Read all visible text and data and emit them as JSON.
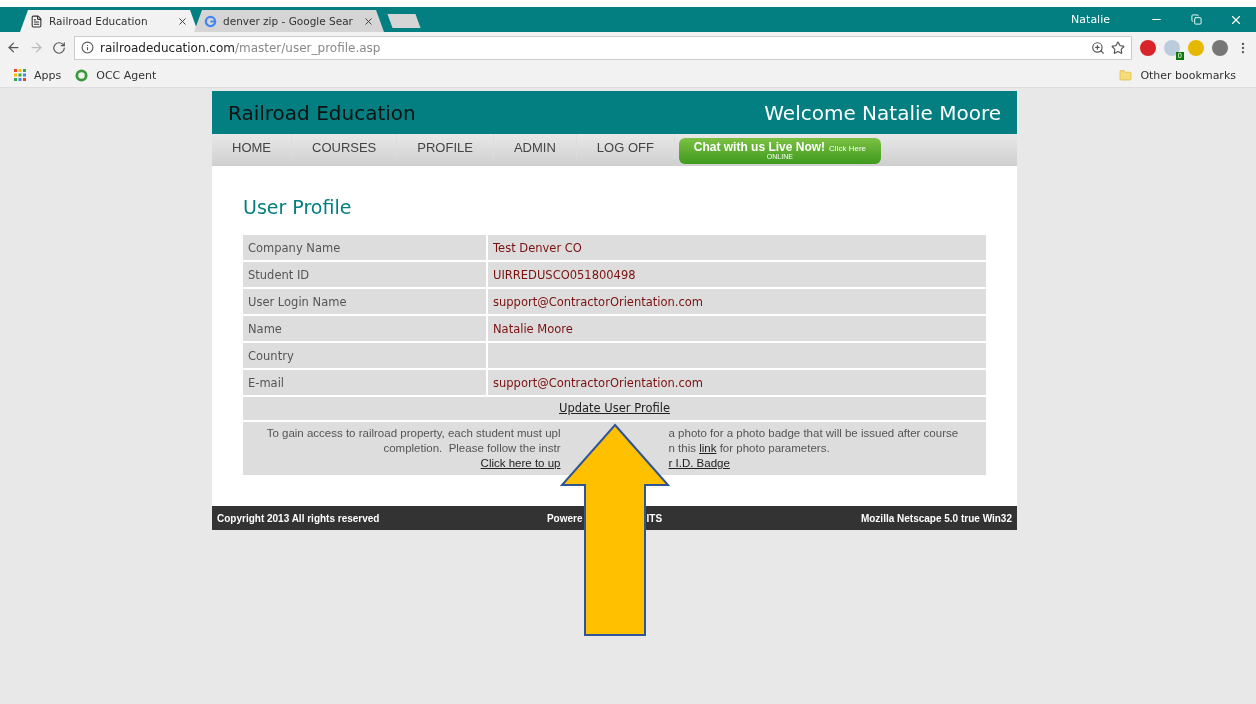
{
  "browser": {
    "tabs": [
      {
        "title": "Railroad Education",
        "selected": true
      },
      {
        "title": "denver zip - Google Sear",
        "selected": false
      }
    ],
    "user": "Natalie",
    "url": {
      "host": "railroadeducation.com",
      "path": "/master/user_profile.asp"
    },
    "bookmarks": [
      {
        "label": "Apps"
      },
      {
        "label": "OCC Agent"
      }
    ],
    "other_bookmarks": "Other bookmarks",
    "extension_badge": "0"
  },
  "site": {
    "title": "Railroad Education",
    "welcome": "Welcome Natalie Moore",
    "nav": [
      {
        "label": "HOME"
      },
      {
        "label": "COURSES"
      },
      {
        "label": "PROFILE"
      },
      {
        "label": "ADMIN"
      },
      {
        "label": "LOG OFF"
      }
    ],
    "chat": {
      "main": "Chat with us Live Now!",
      "small": "Click Here",
      "status": "ONLINE"
    },
    "heading": "User Profile",
    "fields": [
      {
        "label": "Company Name",
        "value": "Test Denver CO"
      },
      {
        "label": "Student ID",
        "value": "UIRREDUSCO051800498"
      },
      {
        "label": "User Login Name",
        "value": "support@ContractorOrientation.com"
      },
      {
        "label": "Name",
        "value": "Natalie  Moore"
      },
      {
        "label": "Country"
      },
      {
        "label": "E-mail",
        "value": "support@ContractorOrientation.com"
      }
    ],
    "update_link": "Update User Profile",
    "notice": {
      "line1": [
        "To gain access to railroad property, each student must upl",
        "a photo for a photo badge that will be issued after course"
      ],
      "line2": [
        "completion.  Please follow the instr",
        "n this"
      ],
      "link": "link",
      "line2_end": "for photo parameters.",
      "upload_link": [
        "Click here to up",
        "r I.D. Badge"
      ]
    },
    "footer": {
      "copyright": "Copyright 2013 All rights reserved",
      "powered": [
        "Powere",
        "ITS"
      ],
      "agent": "Mozilla Netscape 5.0 true Win32"
    }
  }
}
